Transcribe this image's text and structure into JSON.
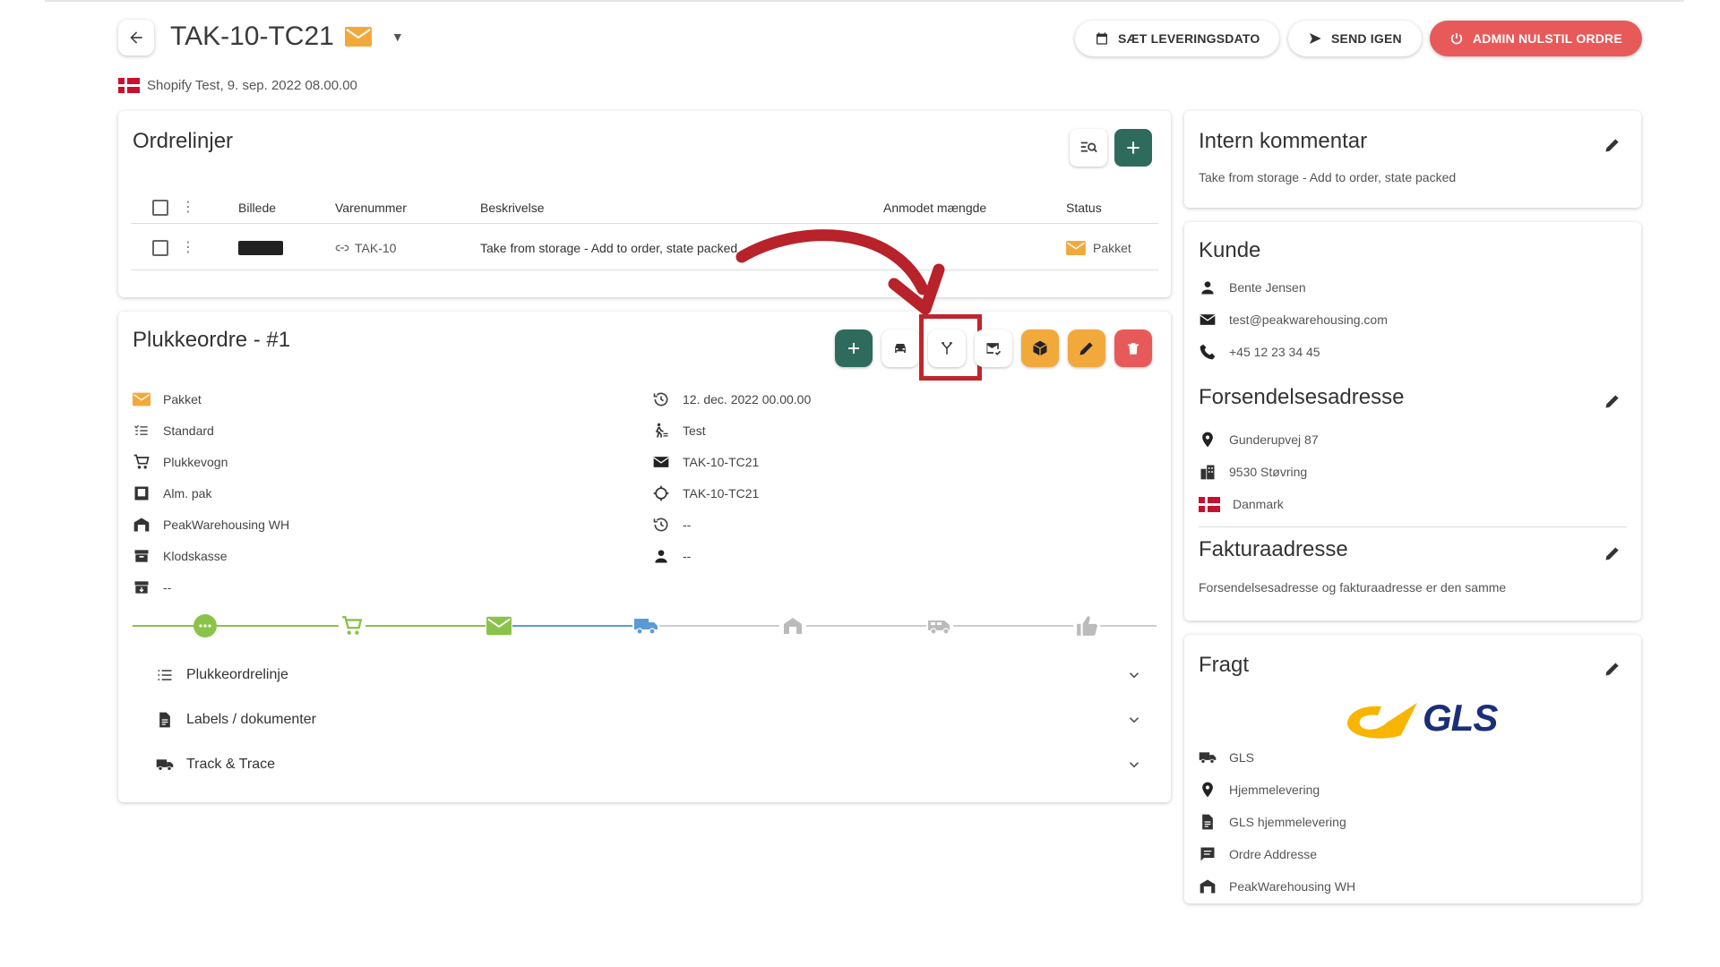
{
  "header": {
    "order_id": "TAK-10-TC21",
    "subline": "Shopify Test, 9. sep. 2022 08.00.00",
    "buttons": {
      "set_delivery": "SÆT LEVERINGSDATO",
      "resend": "SEND IGEN",
      "admin_reset": "ADMIN NULSTIL ORDRE"
    }
  },
  "orderlines": {
    "title": "Ordrelinjer",
    "columns": [
      "Billede",
      "Varenummer",
      "Beskrivelse",
      "Anmodet mængde",
      "Status"
    ],
    "rows": [
      {
        "sku": "TAK-10",
        "description": "Take from storage - Add to order, state packed",
        "quantity": "",
        "status": "Pakket"
      }
    ]
  },
  "pick": {
    "title": "Plukkeordre - #1",
    "left_items": [
      "Pakket",
      "Standard",
      "Plukkevogn",
      "Alm. pak",
      "PeakWarehousing WH",
      "Klodskasse",
      "--"
    ],
    "right_items": [
      "12. dec. 2022 00.00.00",
      "Test",
      "TAK-10-TC21",
      "TAK-10-TC21",
      "--",
      "--"
    ],
    "accordions": [
      "Plukkeordrelinje",
      "Labels / dokumenter",
      "Track & Trace"
    ],
    "colors": {
      "green": "#2f6b5c",
      "orange": "#f2a93b",
      "red": "#e85a5a",
      "progress_green": "#8bc34a",
      "progress_blue": "#5b9bd5"
    }
  },
  "comment": {
    "title": "Intern kommentar",
    "text": "Take from storage - Add to order, state packed"
  },
  "customer": {
    "title": "Kunde",
    "name": "Bente Jensen",
    "email": "test@peakwarehousing.com",
    "phone": "+45 12 23 34 45"
  },
  "shipping": {
    "title": "Forsendelsesadresse",
    "street": "Gunderupvej 87",
    "city": "9530 Støvring",
    "country": "Danmark"
  },
  "billing": {
    "title": "Fakturaadresse",
    "text": "Forsendelsesadresse og fakturaadresse er den samme"
  },
  "freight": {
    "title": "Fragt",
    "logo": "GLS",
    "carrier": "GLS",
    "type": "Hjemmelevering",
    "product": "GLS hjemmelevering",
    "address": "Ordre Addresse",
    "warehouse": "PeakWarehousing WH"
  }
}
